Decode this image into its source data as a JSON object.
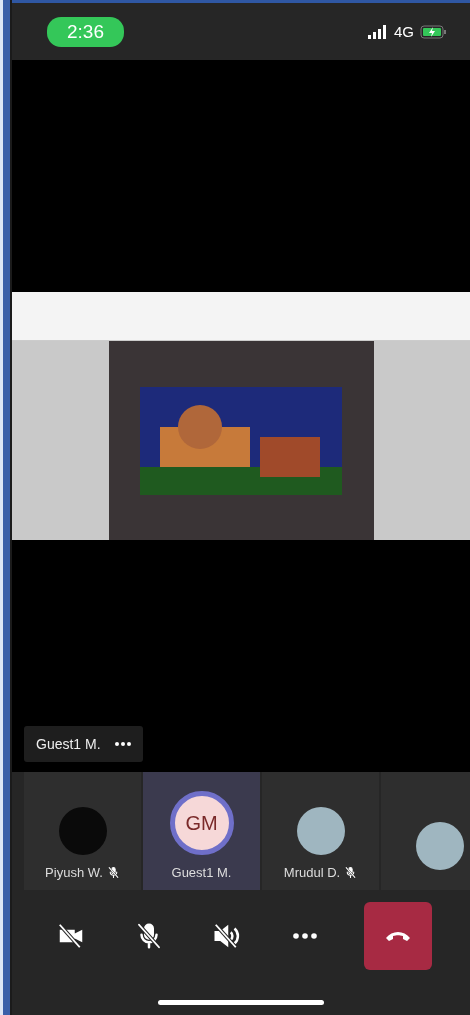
{
  "status_bar": {
    "time": "2:36",
    "network": "4G"
  },
  "pinned_label": {
    "name": "Guest1 M."
  },
  "participants": [
    {
      "name": "Piyush W.",
      "kind": "blank",
      "muted": true,
      "selected": false
    },
    {
      "name": "Guest1 M.",
      "kind": "initials",
      "initials": "GM",
      "muted": false,
      "selected": true
    },
    {
      "name": "Mrudul D.",
      "kind": "photo",
      "muted": true,
      "selected": false
    },
    {
      "kind": "photo",
      "selected": false
    }
  ]
}
